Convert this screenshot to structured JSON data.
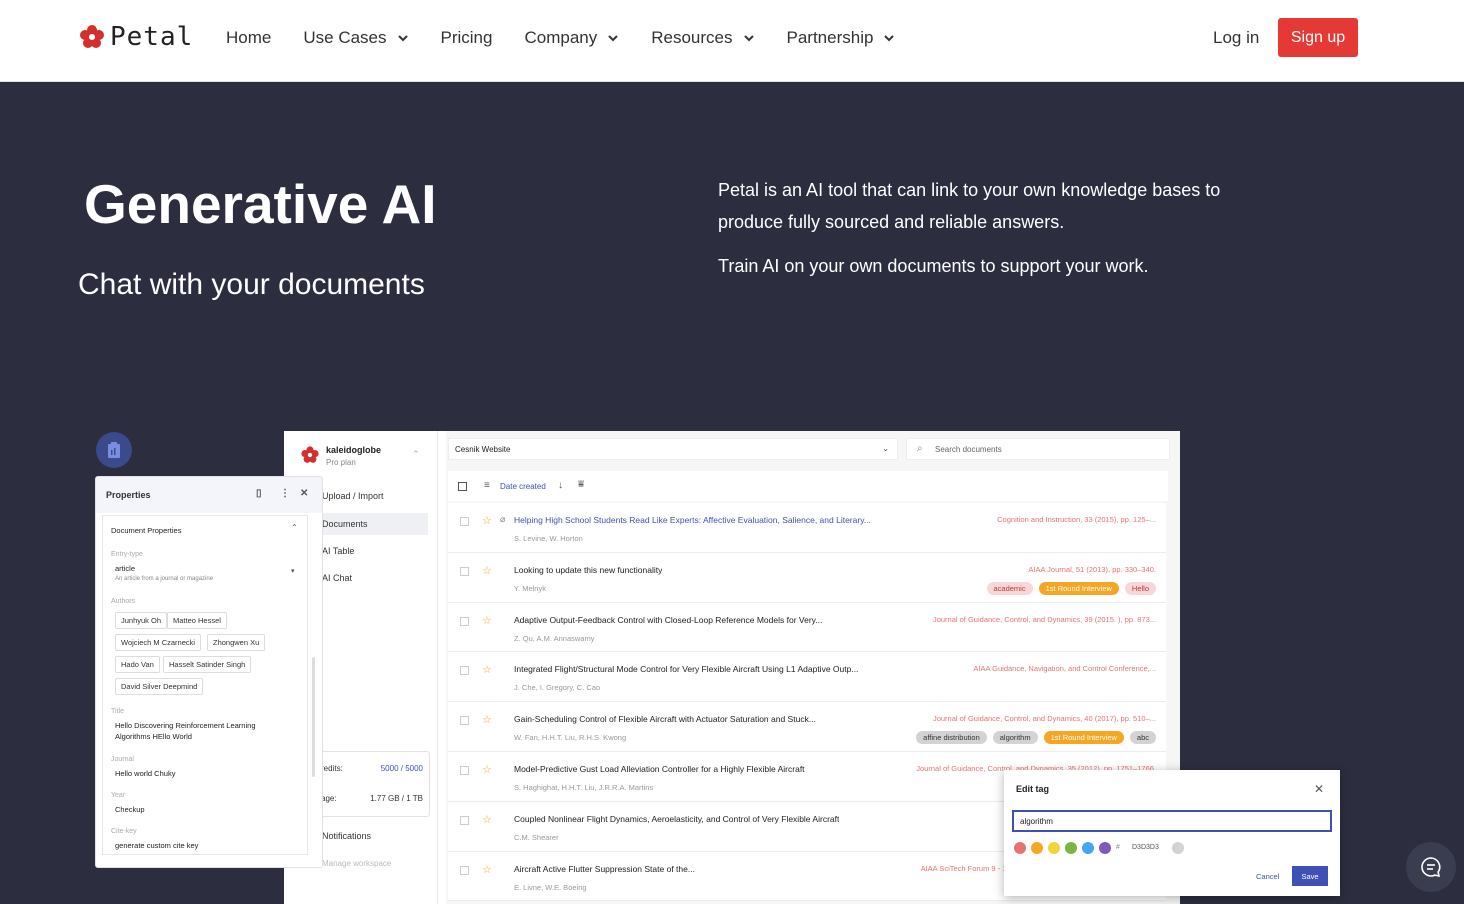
{
  "nav": {
    "brand": "Petal",
    "items": [
      {
        "label": "Home",
        "has_dropdown": false
      },
      {
        "label": "Use Cases",
        "has_dropdown": true
      },
      {
        "label": "Pricing",
        "has_dropdown": false
      },
      {
        "label": "Company",
        "has_dropdown": true
      },
      {
        "label": "Resources",
        "has_dropdown": true
      },
      {
        "label": "Partnership",
        "has_dropdown": true
      }
    ],
    "login": "Log in",
    "signup": "Sign up"
  },
  "hero": {
    "title": "Generative AI",
    "subtitle": "Chat with your documents",
    "desc1": "Petal is an AI tool that can link to your own knowledge bases to produce fully sourced and reliable answers.",
    "desc2": "Train AI on your own documents to support your work."
  },
  "app": {
    "workspace": {
      "name": "kaleidoglobe",
      "plan": "Pro plan"
    },
    "sidebar": [
      "Upload / Import",
      "Documents",
      "AI Table",
      "AI Chat"
    ],
    "credits": {
      "credits_label": "redits:",
      "credits_value": "5000 / 5000",
      "storage_label": "age:",
      "storage_value": "1.77 GB / 1 TB"
    },
    "notifications": "Notifications",
    "manage": "Manage workspace",
    "project": "Cesnik Website",
    "search_placeholder": "Search documents",
    "sort": "Date created",
    "documents": [
      {
        "title": "Helping High School Students Read Like Experts: Affective Evaluation, Salience, and Literary...",
        "authors": "S. Levine, W. Horton",
        "source": "Cognition and Instruction, 33 (2015), pp. 125–...",
        "tags": [],
        "link": true
      },
      {
        "title": "Looking to update this new functionality",
        "authors": "Y. Melnyk",
        "source": "AIAA Journal, 51 (2013), pp. 330–340.",
        "tags": [
          {
            "label": "academic",
            "style": "red"
          },
          {
            "label": "1st Round Interview",
            "style": "orange"
          },
          {
            "label": "Hello",
            "style": "red"
          }
        ],
        "link": false
      },
      {
        "title": "Adaptive Output-Feedback Control with Closed-Loop Reference Models for Very...",
        "authors": "Z. Qu, A.M. Annaswamy",
        "source": "Journal of Guidance, Control, and Dynamics, 39 (2015. ), pp. 873...",
        "tags": [],
        "link": false
      },
      {
        "title": "Integrated Flight/Structural Mode Control for Very Flexible Aircraft Using L1 Adaptive Outp...",
        "authors": "J. Che, I. Gregory, C. Cao",
        "source": "AIAA Guidance, Navigation, and Control Conference,...",
        "tags": [],
        "link": false
      },
      {
        "title": "Gain-Scheduling Control of Flexible Aircraft with Actuator Saturation and Stuck...",
        "authors": "W. Fan, H.H.T. Liu, R.H.S. Kwong",
        "source": "Journal of Guidance, Control, and Dynamics, 40 (2017), pp. 510–...",
        "tags": [
          {
            "label": "affine distribution",
            "style": "grey"
          },
          {
            "label": "algorithm",
            "style": "grey"
          },
          {
            "label": "1st Round Interview",
            "style": "orange"
          },
          {
            "label": "abc",
            "style": "grey"
          }
        ],
        "link": false
      },
      {
        "title": "Model-Predictive Gust Load Alleviation Controller for a Highly Flexible Aircraft",
        "authors": "S. Haghighat, H.H.T. Liu, J.R.R.A. Martins",
        "source": "Journal of Guidance, Control, and Dynamics, 35 (2012), pp. 1751–1766.",
        "tags": [],
        "link": false
      },
      {
        "title": "Coupled Nonlinear Flight Dynamics, Aeroelasticity, and Control of Very Flexible Aircraft",
        "authors": "C.M. Shearer",
        "source": "",
        "tags": [],
        "link": false
      },
      {
        "title": "Aircraft Active Flutter Suppression State of the...",
        "authors": "E. Livne, W.E. Boeing",
        "source": "AIAA SciTech Forum 9 - 13 January 2017, Grapevine, Texas 58th AIAA",
        "tags": [],
        "link": false
      }
    ]
  },
  "properties": {
    "title": "Properties",
    "section": "Document Properties",
    "entry_type_label": "Entry-type",
    "entry_type": "article",
    "entry_type_desc": "An article from a journal or magazine",
    "authors_label": "Authors",
    "authors": [
      "Junhyuk Oh",
      "Matteo Hessel",
      "Wojciech M Czarnecki",
      "Zhongwen Xu",
      "Hado Van",
      "Hasselt Satinder Singh",
      "David Silver Deepmind"
    ],
    "title_label": "Title",
    "title_value": "Hello Discovering Reinforcement Learning Algorithms HEllo World",
    "journal_label": "Journal",
    "journal": "Hello world Chuky",
    "year_label": "Year",
    "year": "Checkup",
    "citekey_label": "Cite-key",
    "citekey": "generate custom cite key"
  },
  "edit_tag": {
    "title": "Edit tag",
    "value": "algorithm",
    "hex": "D3D3D3",
    "cancel": "Cancel",
    "save": "Save",
    "colors": [
      "#e57373",
      "#f5a623",
      "#f2d43d",
      "#7cb342",
      "#42a5f5",
      "#7e57c2"
    ]
  },
  "colors": {
    "accent": "#e53935",
    "primary": "#3f51b5",
    "hero_bg": "#2c2e3f"
  }
}
